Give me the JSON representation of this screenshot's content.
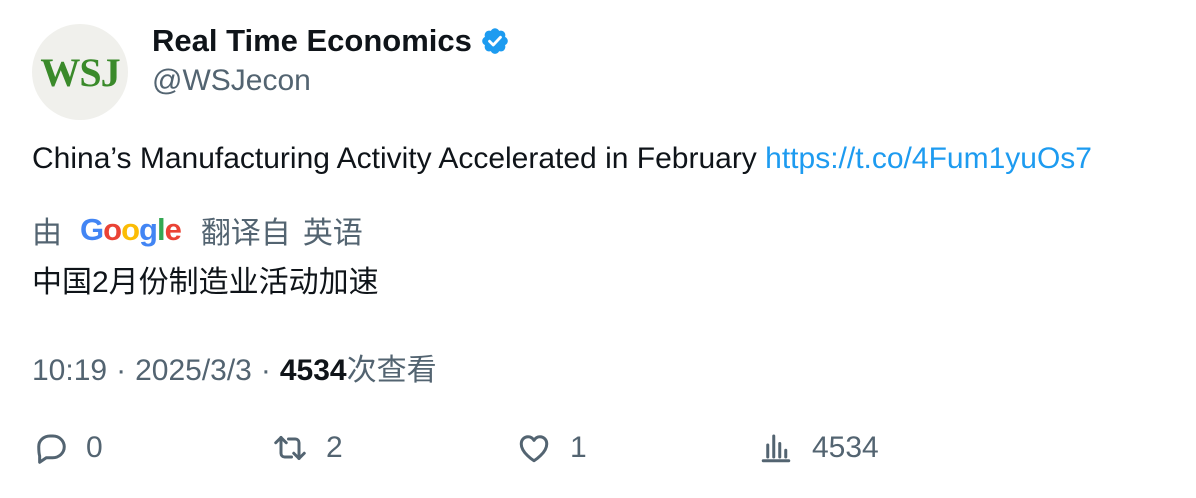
{
  "author": {
    "avatar_text": "WSJ",
    "display_name": "Real Time Economics",
    "handle": "@WSJecon",
    "verified": true
  },
  "tweet": {
    "text": "China’s Manufacturing Activity Accelerated in February",
    "link": "https://t.co/4Fum1yuOs7"
  },
  "translation": {
    "by_label": "由",
    "provider_letters": [
      "G",
      "o",
      "o",
      "g",
      "l",
      "e"
    ],
    "from_label": "翻译自",
    "language": "英语",
    "text": "中国2月份制造业活动加速"
  },
  "meta": {
    "time": "10:19",
    "separator": "·",
    "date": "2025/3/3",
    "views_count": "4534",
    "views_label": "次查看"
  },
  "actions": {
    "replies": "0",
    "retweets": "2",
    "likes": "1",
    "views": "4534"
  },
  "colors": {
    "text_primary": "#0f1419",
    "text_secondary": "#536471",
    "link": "#1d9bf0",
    "verified_badge": "#1d9bf0",
    "avatar_logo": "#3a8a2a"
  },
  "icons": {
    "verified": "verified-badge-icon",
    "reply": "reply-icon",
    "retweet": "retweet-icon",
    "like": "heart-icon",
    "views": "bar-chart-icon"
  }
}
